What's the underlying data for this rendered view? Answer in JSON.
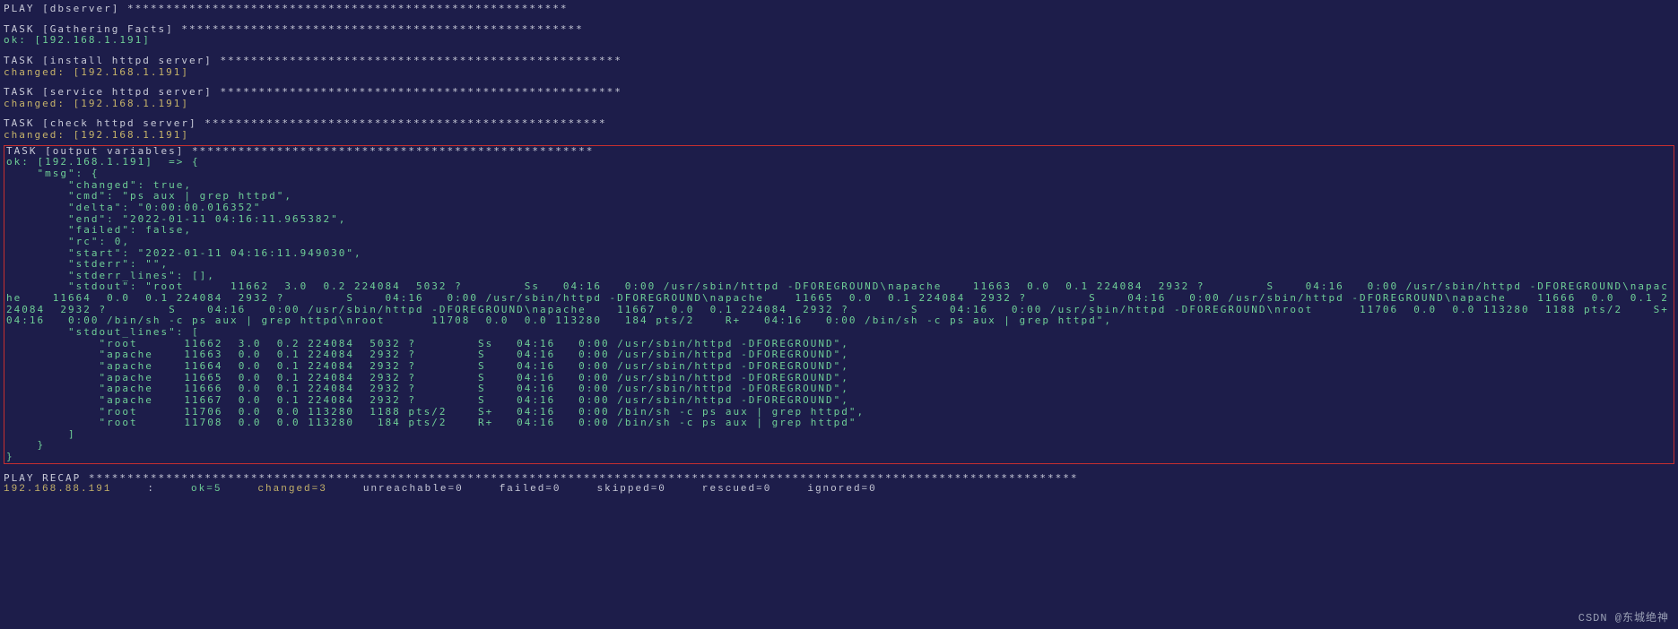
{
  "asterisks": "*********************************************************",
  "asterisks_short": "****************************************************",
  "asterisks_mid": "****************************************************",
  "asterisks_recap": "********************************************************************************************************************************",
  "play": {
    "header": "PLAY [dbserver]"
  },
  "task_gather": {
    "header": "TASK [Gathering Facts]",
    "result": "ok: [192.168.1.191]"
  },
  "task_install": {
    "header": "TASK [install httpd server]",
    "result": "changed: [192.168.1.191]"
  },
  "task_service": {
    "header": "TASK [service httpd server]",
    "result": "changed: [192.168.1.191]"
  },
  "task_check": {
    "header": "TASK [check httpd server]",
    "result": "changed: [192.168.1.191]"
  },
  "task_output": {
    "header": "TASK [output variables]",
    "ok_prefix": "ok: [192.168.1.191]  => {",
    "msg_key": "    \"msg\": {",
    "changed": "        \"changed\": true,",
    "cmd": "        \"cmd\": \"ps aux | grep httpd\",",
    "delta": "        \"delta\": \"0:00:00.016352\"",
    "end": "        \"end\": \"2022-01-11 04:16:11.965382\",",
    "failed": "        \"failed\": false,",
    "rc": "        \"rc\": 0,",
    "start": "        \"start\": \"2022-01-11 04:16:11.949030\",",
    "stderr": "        \"stderr\": \"\",",
    "stderr_lines": "        \"stderr_lines\": [],",
    "stdout": "        \"stdout\": \"root      11662  3.0  0.2 224084  5032 ?        Ss   04:16   0:00 /usr/sbin/httpd -DFOREGROUND\\napache    11663  0.0  0.1 224084  2932 ?        S    04:16   0:00 /usr/sbin/httpd -DFOREGROUND\\napache    11664  0.0  0.1 224084  2932 ?        S    04:16   0:00 /usr/sbin/httpd -DFOREGROUND\\napache    11665  0.0  0.1 224084  2932 ?        S    04:16   0:00 /usr/sbin/httpd -DFOREGROUND\\napache    11666  0.0  0.1 224084  2932 ?        S    04:16   0:00 /usr/sbin/httpd -DFOREGROUND\\napache    11667  0.0  0.1 224084  2932 ?        S    04:16   0:00 /usr/sbin/httpd -DFOREGROUND\\nroot      11706  0.0  0.0 113280  1188 pts/2    S+   04:16   0:00 /bin/sh -c ps aux | grep httpd\\nroot      11708  0.0  0.0 113280   184 pts/2    R+   04:16   0:00 /bin/sh -c ps aux | grep httpd\",",
    "stdout_lines_key": "        \"stdout_lines\": [",
    "sl0": "            \"root      11662  3.0  0.2 224084  5032 ?        Ss   04:16   0:00 /usr/sbin/httpd -DFOREGROUND\",",
    "sl1": "            \"apache    11663  0.0  0.1 224084  2932 ?        S    04:16   0:00 /usr/sbin/httpd -DFOREGROUND\",",
    "sl2": "            \"apache    11664  0.0  0.1 224084  2932 ?        S    04:16   0:00 /usr/sbin/httpd -DFOREGROUND\",",
    "sl3": "            \"apache    11665  0.0  0.1 224084  2932 ?        S    04:16   0:00 /usr/sbin/httpd -DFOREGROUND\",",
    "sl4": "            \"apache    11666  0.0  0.1 224084  2932 ?        S    04:16   0:00 /usr/sbin/httpd -DFOREGROUND\",",
    "sl5": "            \"apache    11667  0.0  0.1 224084  2932 ?        S    04:16   0:00 /usr/sbin/httpd -DFOREGROUND\",",
    "sl6": "            \"root      11706  0.0  0.0 113280  1188 pts/2    S+   04:16   0:00 /bin/sh -c ps aux | grep httpd\",",
    "sl7": "            \"root      11708  0.0  0.0 113280   184 pts/2    R+   04:16   0:00 /bin/sh -c ps aux | grep httpd\"",
    "sl_close": "        ]",
    "msg_close": "    }",
    "root_close": "}"
  },
  "recap": {
    "header": "PLAY RECAP",
    "host": "192.168.88.191",
    "colon": ":",
    "ok": "ok=5",
    "changed": "changed=3",
    "unreachable": "unreachable=0",
    "failed": "failed=0",
    "skipped": "skipped=0",
    "rescued": "rescued=0",
    "ignored": "ignored=0"
  },
  "watermark": "CSDN @东城绝神"
}
